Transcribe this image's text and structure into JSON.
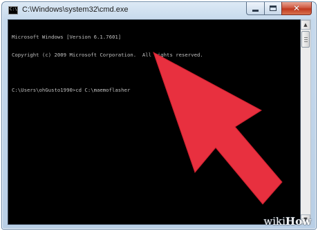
{
  "window": {
    "title": "C:\\Windows\\system32\\cmd.exe",
    "icon": "cmd-icon",
    "icon_glyph": "C:\\",
    "buttons": {
      "minimize": "minimize-icon",
      "maximize": "maximize-icon",
      "close": "close-icon",
      "close_glyph": "✕"
    }
  },
  "console": {
    "lines": [
      "Microsoft Windows [Version 6.1.7601]",
      "Copyright (c) 2009 Microsoft Corporation.  All rights reserved.",
      "",
      "C:\\Users\\ohGusto1990>cd C:\\maemoflasher"
    ],
    "background": "#000000",
    "foreground": "#c0c0c0"
  },
  "scrollbar": {
    "up_glyph": "▲",
    "down_glyph": "▼"
  },
  "annotation": {
    "arrow_color": "#e8303f",
    "arrow_icon": "red-pointer-arrow"
  },
  "watermark": {
    "prefix": "wiki",
    "suffix": "How"
  }
}
